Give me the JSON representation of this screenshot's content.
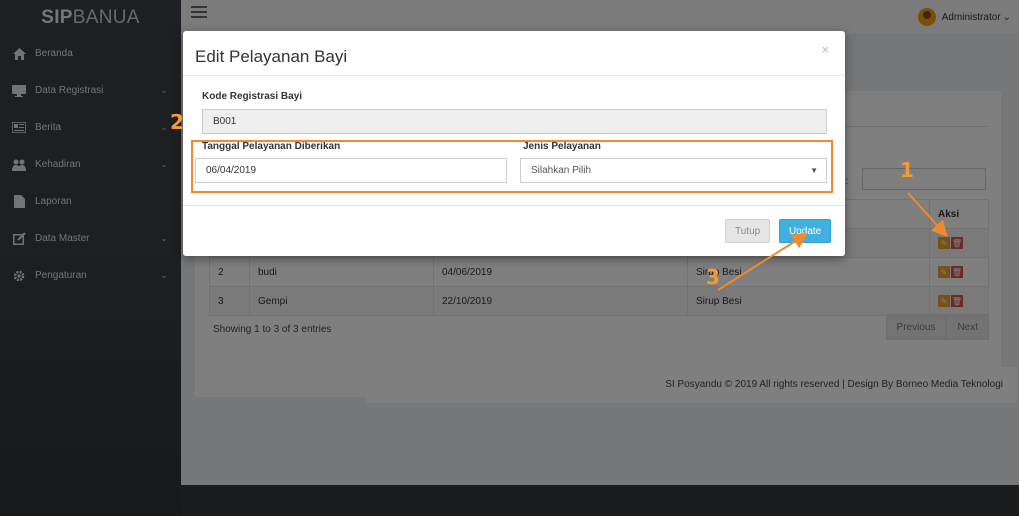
{
  "sidebar": {
    "brand_bold": "SIP",
    "brand_rest": "BANUA",
    "items": [
      {
        "label": "Beranda",
        "icon": "home-icon",
        "has_chevron": false
      },
      {
        "label": "Data Registrasi",
        "icon": "monitor-icon",
        "has_chevron": true
      },
      {
        "label": "Berita",
        "icon": "newspaper-icon",
        "has_chevron": true
      },
      {
        "label": "Kehadiran",
        "icon": "users-icon",
        "has_chevron": true
      },
      {
        "label": "Laporan",
        "icon": "file-icon",
        "has_chevron": false
      },
      {
        "label": "Data Master",
        "icon": "edit-icon",
        "has_chevron": true
      },
      {
        "label": "Pengaturan",
        "icon": "gear-icon",
        "has_chevron": true
      }
    ]
  },
  "header": {
    "user_name": "Administrator",
    "user_chevron": "⌄"
  },
  "table": {
    "search_label": "ch:",
    "headers": {
      "aksi": "Aksi"
    },
    "rows": [
      {
        "no": "2",
        "nama": "budi",
        "tanggal": "04/06/2019",
        "jenis": "Sirup Besi"
      },
      {
        "no": "3",
        "nama": "Gempi",
        "tanggal": "22/10/2019",
        "jenis": "Sirup Besi"
      }
    ],
    "showing": "Showing 1 to 3 of 3 entries",
    "prev": "Previous",
    "next": "Next"
  },
  "footer": {
    "text": "SI Posyandu © 2019 All rights reserved | Design By Borneo Media Teknologi"
  },
  "modal": {
    "title": "Edit Pelayanan Bayi",
    "close": "×",
    "kode_label": "Kode Registrasi Bayi",
    "kode_value": "B001",
    "tanggal_label": "Tanggal Pelayanan Diberikan",
    "tanggal_value": "06/04/2019",
    "jenis_label": "Jenis Pelayanan",
    "jenis_value": "Silahkan Pilih",
    "btn_tutup": "Tutup",
    "btn_update": "Update"
  },
  "annotations": {
    "step1": "1",
    "step2": "2",
    "step3": "3",
    "color": "#f08a2c"
  }
}
